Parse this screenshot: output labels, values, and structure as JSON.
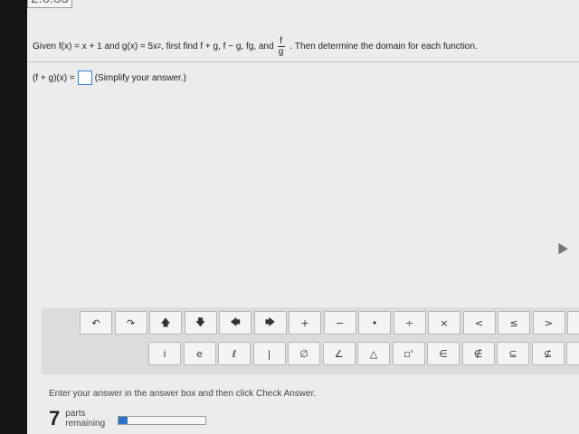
{
  "problem": {
    "id": "2.6.33",
    "prompt_before": "Given f(x) = x + 1 and g(x) = 5x",
    "exponent": "2",
    "prompt_middle": ", first find f + g, f − g, fg, and",
    "frac_num": "f",
    "frac_den": "g",
    "prompt_after": ". Then determine the domain for each function."
  },
  "answer": {
    "label": "(f + g)(x) =",
    "value": "",
    "hint": "(Simplify your answer.)"
  },
  "palette": {
    "row1": [
      "↶",
      "↷",
      "🡅",
      "🡇",
      "🡄",
      "🡆",
      "+",
      "−",
      "•",
      "÷",
      "×",
      "<",
      "≤",
      ">",
      "≥"
    ],
    "row2": [
      "i",
      "e",
      "ℓ",
      "|",
      "∅",
      "∠",
      "△",
      "▫'",
      "∈",
      "∉",
      "⊆",
      "⊈",
      "⊂"
    ]
  },
  "footer": {
    "message": "Enter your answer in the answer box and then click Check Answer.",
    "parts_count": "7",
    "parts_label_1": "parts",
    "parts_label_2": "remaining",
    "progress_fraction": 0.1
  },
  "colors": {
    "accent": "#2c72c8",
    "answer_border": "#3a7fd0"
  }
}
